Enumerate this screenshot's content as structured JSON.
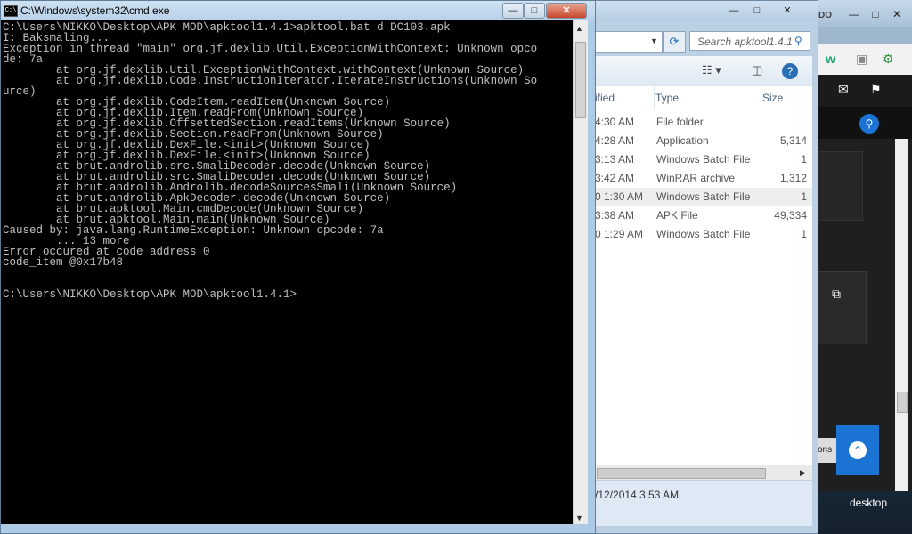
{
  "desktop": {
    "label": "desktop"
  },
  "cmd": {
    "title": "C:\\Windows\\system32\\cmd.exe",
    "lines": [
      "C:\\Users\\NIKKO\\Desktop\\APK MOD\\apktool1.4.1>apktool.bat d DC103.apk",
      "I: Baksmaling...",
      "Exception in thread \"main\" org.jf.dexlib.Util.ExceptionWithContext: Unknown opco",
      "de: 7a",
      "        at org.jf.dexlib.Util.ExceptionWithContext.withContext(Unknown Source)",
      "        at org.jf.dexlib.Code.InstructionIterator.IterateInstructions(Unknown So",
      "urce)",
      "        at org.jf.dexlib.CodeItem.readItem(Unknown Source)",
      "        at org.jf.dexlib.Item.readFrom(Unknown Source)",
      "        at org.jf.dexlib.OffsettedSection.readItems(Unknown Source)",
      "        at org.jf.dexlib.Section.readFrom(Unknown Source)",
      "        at org.jf.dexlib.DexFile.<init>(Unknown Source)",
      "        at org.jf.dexlib.DexFile.<init>(Unknown Source)",
      "        at brut.androlib.src.SmaliDecoder.decode(Unknown Source)",
      "        at brut.androlib.src.SmaliDecoder.decode(Unknown Source)",
      "        at brut.androlib.Androlib.decodeSourcesSmali(Unknown Source)",
      "        at brut.androlib.ApkDecoder.decode(Unknown Source)",
      "        at brut.apktool.Main.cmdDecode(Unknown Source)",
      "        at brut.apktool.Main.main(Unknown Source)",
      "Caused by: java.lang.RuntimeException: Unknown opcode: 7a",
      "        ... 13 more",
      "Error occured at code address 0",
      "code_item @0x17b48",
      "",
      "C:\\Users\\NIKKO\\Desktop\\APK MOD\\apktool1.4.1>"
    ],
    "controls": {
      "minimize": "—",
      "maximize": "□",
      "close": "✕"
    }
  },
  "explorer": {
    "search_placeholder": "Search apktool1.4.1",
    "columns": {
      "date": "ified",
      "type": "Type",
      "size": "Size"
    },
    "rows": [
      {
        "date": "4:30 AM",
        "type": "File folder",
        "size": ""
      },
      {
        "date": "4:28 AM",
        "type": "Application",
        "size": "5,314"
      },
      {
        "date": "3:13 AM",
        "type": "Windows Batch File",
        "size": "1"
      },
      {
        "date": "3:42 AM",
        "type": "WinRAR archive",
        "size": "1,312"
      },
      {
        "date": "0 1:30 AM",
        "type": "Windows Batch File",
        "size": "1"
      },
      {
        "date": "3:38 AM",
        "type": "APK File",
        "size": "49,334"
      },
      {
        "date": "0 1:29 AM",
        "type": "Windows Batch File",
        "size": "1"
      }
    ],
    "status": "/12/2014 3:53 AM",
    "controls": {
      "minimize": "—",
      "maximize": "□",
      "close": "✕"
    }
  },
  "browser": {
    "brand": "DO",
    "controls": {
      "minimize": "—",
      "maximize": "□",
      "close": "✕"
    },
    "tag_text": "tions"
  }
}
